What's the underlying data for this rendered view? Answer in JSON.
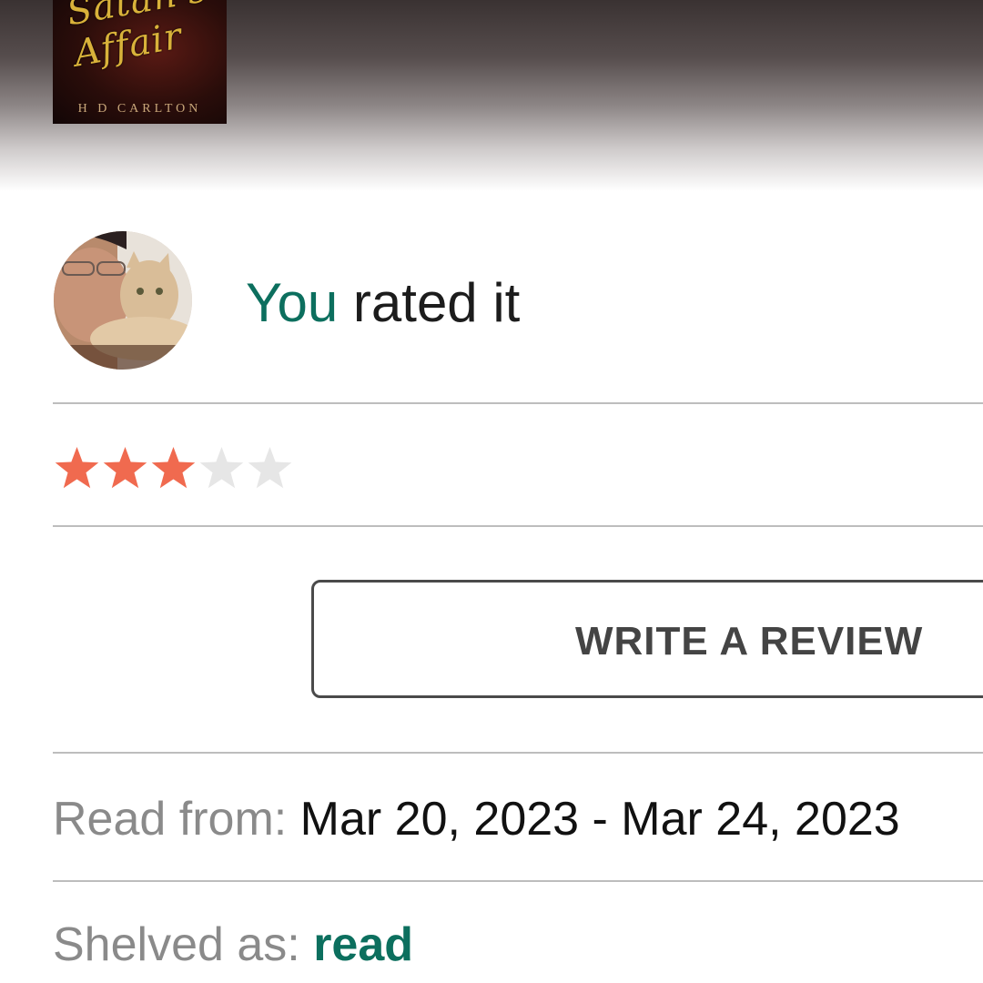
{
  "book": {
    "cover_title": "Satan's\nAffair",
    "cover_author": "H D CARLTON"
  },
  "rating": {
    "you_label": "You",
    "rated_text": "rated it",
    "stars_filled": 3,
    "stars_total": 5
  },
  "review_button": {
    "label": "WRITE A REVIEW"
  },
  "read_dates": {
    "label": "Read from:",
    "value": "Mar 20, 2023 - Mar 24, 2023"
  },
  "shelf": {
    "label": "Shelved as:",
    "value": "read"
  },
  "colors": {
    "accent": "#0c6f5e",
    "star_filled": "#f06a4f",
    "star_empty": "#e6e6e6",
    "divider": "#bdbdbd"
  },
  "icons": [
    "star-icon"
  ]
}
